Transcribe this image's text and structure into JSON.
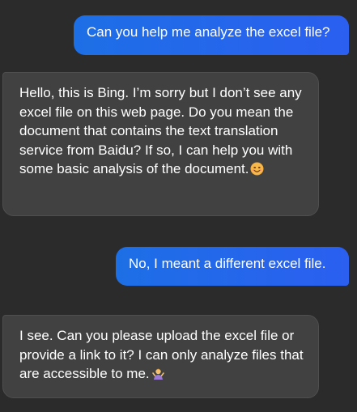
{
  "messages": [
    {
      "role": "user",
      "text": "Can you help me analyze the excel file?"
    },
    {
      "role": "assistant",
      "text": "Hello, this is Bing. I’m sorry but I don’t see any excel file on this web page. Do you mean the document that contains the text translation service from Baidu? If so, I can help you with some basic analysis of the document.",
      "emoji": "smiling-face-icon"
    },
    {
      "role": "user",
      "text": "No, I meant a different excel file."
    },
    {
      "role": "assistant",
      "text": "I see. Can you please upload the excel file or provide a link to it? I can only analyze files that are accessible to me.",
      "emoji": "person-shrugging-icon"
    }
  ],
  "colors": {
    "background": "#2b2b2b",
    "user_bubble": "#2568ee",
    "assistant_bubble": "#414141",
    "text": "#ffffff"
  }
}
